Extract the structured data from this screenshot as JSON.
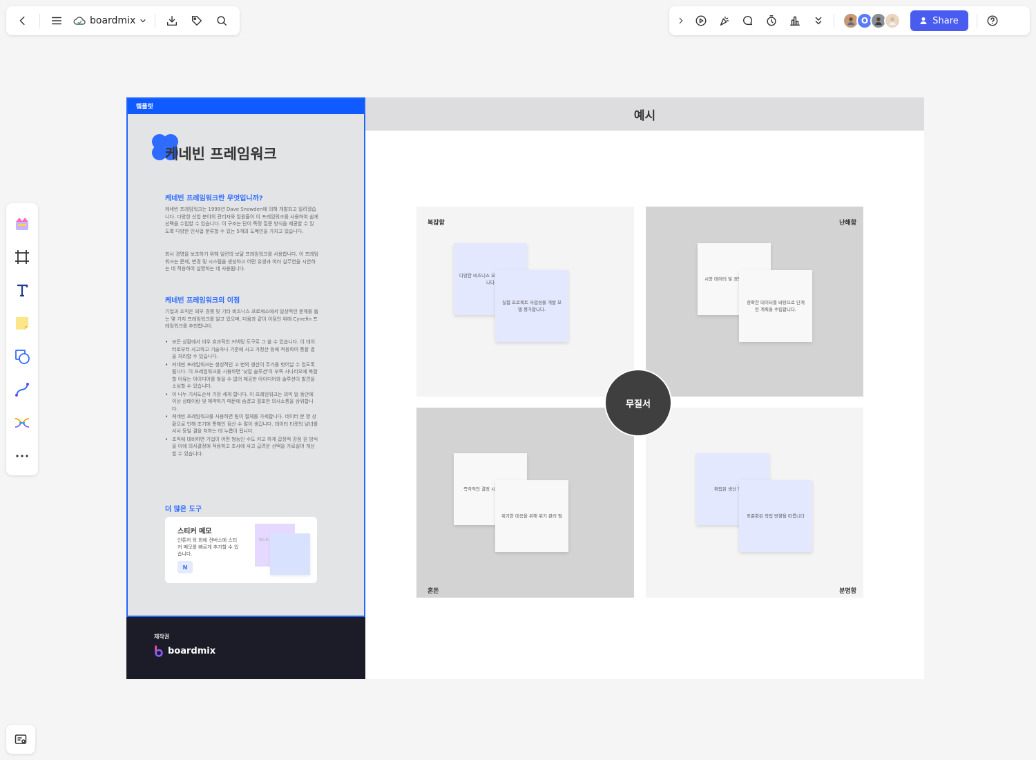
{
  "header": {
    "app_name": "boardmix",
    "share_label": "Share",
    "avatar_letter": "O"
  },
  "template": {
    "tag": "템플릿",
    "title": "케네빈 프레임워크",
    "section1_title": "케네빈 프레임워크란 무엇입니까?",
    "section1_p1": "케네빈 프레임워크는 1999년 Dave Snowden에 의해 개발되고 알려졌습니다. 다양한 산업 분야의 관리자와 임원들이 이 프레임워크를 사용하여 쉽게 선택을 수립할 수 있습니다. 이 구조는 단이 특정 질문 방식을 제공할 수 있도록 다양한 인사업 분류할 수 있는 5개의 도메인을 가지고 있습니다.",
    "section1_p2": "회사 경영을 보조하기 위해 일련의 보달 프레임워크를 사용합니다. 이 프레임워크는 문제, 변경 및 시스템을 생성하고 어떤 유생과 여러 실무연을 시연하는 데 적응하여 설명하는 데 사용됩니다.",
    "section2_title": "케네빈 프레임워크의 이점",
    "section2_p": "기업과 조직은 외부 경쟁 및 기타 비즈니스 프로세스에서 일상적인 문제를 돕는 몇 가지 프레임워크를 알고 있으며, 다음과 같이 이점인 위에 Cynefin 프레임워크를 추천합니다.",
    "bullets": [
      "보든 상황에서 비우 효과적인 커넥팅 도구로 그 쓸 수 있습니다. 이 데이터로부터 사고하고 기술자나 기준에 사고 가정산 등에 적응하여 통찰 결을 처리할 수 있습니다.",
      "커네빈 프레임워크는 생성적인 고 변의 생산이 주가를 벗어날 수 있도록 됩니다. 이 프레임워크를 시용하면 '낮잡 솔루션'이 부족 사나리오에 복합할 이유는 아이디어를 찾을 수 없어 제공한 아이디어와 솔루션이 발견을 소심할 수 있습니다.",
      "이 나누 기사도순서 가장 세게 합니다. 이 프레임워크는 의미 잃 동안에 이상 상태이랑 및 제약하기 때문에 숨겼고 절호한 의사소통을 상위합니다.",
      "케네빈 프레임워크를 사용하면 팀이 절체를 가세합니다. 데이터 문 향 상황으로 인해 조기에 통해인 점산 수 많이 생깁니다. 데이터 타켓의 남녀를 서서 등일 결을 처하는 데 누릅이 됩니다.",
      "조직에 대비하면 기업이 어떤 형능인 수도 커고 하게 갑장적 강점 원 방식을 이에 의사결정에 적용하고 조사에 사고 급려운 선택을 가로실어 개선할 수 있습니다."
    ],
    "more_tools": "더 많은 도구",
    "sticky_title": "스티커 메모",
    "sticky_desc": "인튜커 워 화에 전버스에 스티커 메모를 빠르게 추가할 수 있습니다.",
    "sticky_badge": "N",
    "mini_note_text": "텍스트 추가",
    "author_label": "제작권",
    "footer_brand": "boardmix"
  },
  "example": {
    "header": "예시",
    "center": "무질서",
    "quadrants": {
      "tl": {
        "label": "복잡함",
        "note1": "다양한 비즈니스 모델을 테스트합니다",
        "note2": "실험 프로젝트 사업성을 개발 모델 평가합니다."
      },
      "tr": {
        "label": "난해함",
        "note1": "시장 데이터 및 경쟁 분석합니다",
        "note2": "정확한 데이터를 바탕으로 단계 된 계획을 수립합니다."
      },
      "bl": {
        "label": "혼돈",
        "note1": "즉각적인 결정 시 시행합니다",
        "note2": "위기한 대응을 위해 위기 관리 팀"
      },
      "br": {
        "label": "분명함",
        "note1": "확립된 생산 및 판매",
        "note2": "표준화된 작업 방향을 따릅니다"
      }
    }
  },
  "colors": {
    "accent": "#4a5cf0",
    "template_blue": "#0f5bff",
    "note_blue": "#e4e8ff",
    "note_white": "#f8f8f8",
    "center_dark": "#3f3f3f"
  }
}
